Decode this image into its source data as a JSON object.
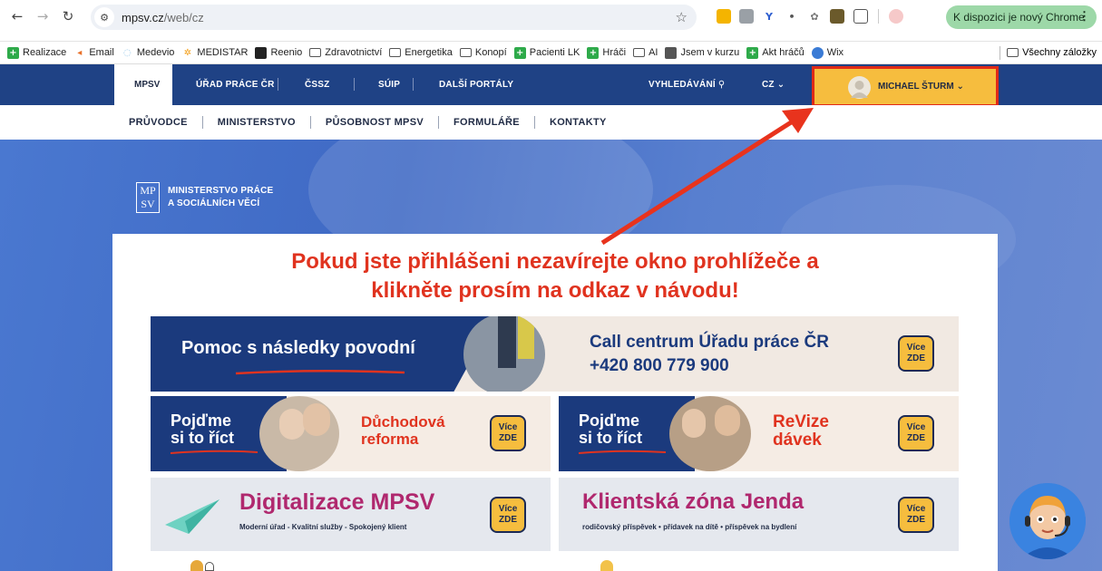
{
  "browser": {
    "url_domain": "mpsv.cz",
    "url_path": "/web/cz",
    "update_label": "K dispozici je nový Chrome",
    "bookmarks": [
      "Realizace",
      "Email",
      "Medevio",
      "MEDISTAR",
      "Reenio",
      "Zdravotnictví",
      "Energetika",
      "Konopí",
      "Pacienti LK",
      "Hráči",
      "AI",
      "Jsem v kurzu",
      "Akt hráčů",
      "Wix"
    ],
    "all_bookmarks": "Všechny záložky"
  },
  "topnav": {
    "items": [
      "MPSV",
      "ÚŘAD PRÁCE ČR",
      "ČSSZ",
      "SÚIP",
      "DALŠÍ PORTÁLY"
    ],
    "search": "VYHLEDÁVÁNÍ",
    "lang": "CZ",
    "user": "MICHAEL ŠTURM"
  },
  "subnav": [
    "PRŮVODCE",
    "MINISTERSTVO",
    "PŮSOBNOST MPSV",
    "FORMULÁŘE",
    "KONTAKTY"
  ],
  "logo": {
    "mark_top": "MP",
    "mark_bottom": "SV",
    "line1": "MINISTERSTVO PRÁCE",
    "line2": "A SOCIÁLNÍCH VĚCÍ"
  },
  "warning": {
    "line1": "Pokud jste přihlášeni nezavírejte okno prohlížeče a",
    "line2": "klikněte prosím na odkaz v návodu!"
  },
  "banners": {
    "flood_title": "Pomoc s následky povodní",
    "call_title": "Call centrum Úřadu práce ČR",
    "call_phone": "+420 800 779 900",
    "talk_line1": "Pojďme",
    "talk_line2": "si to říct",
    "pension_line1": "Důchodová",
    "pension_line2": "reforma",
    "revize_line1": "ReVize",
    "revize_line2": "dávek",
    "digital_title": "Digitalizace MPSV",
    "digital_sub": "Moderní úřad - Kvalitní služby - Spokojený klient",
    "jenda_title": "Klientská zóna Jenda",
    "jenda_sub": "rodičovský příspěvek • přídavek na dítě • příspěvek na bydlení",
    "vice_line1": "Více",
    "vice_line2": "ZDE"
  },
  "colors": {
    "nav_blue": "#1f4285",
    "highlight_yellow": "#f6bd3e",
    "warning_red": "#e0331f",
    "banner_navy": "#1b3a7d"
  }
}
